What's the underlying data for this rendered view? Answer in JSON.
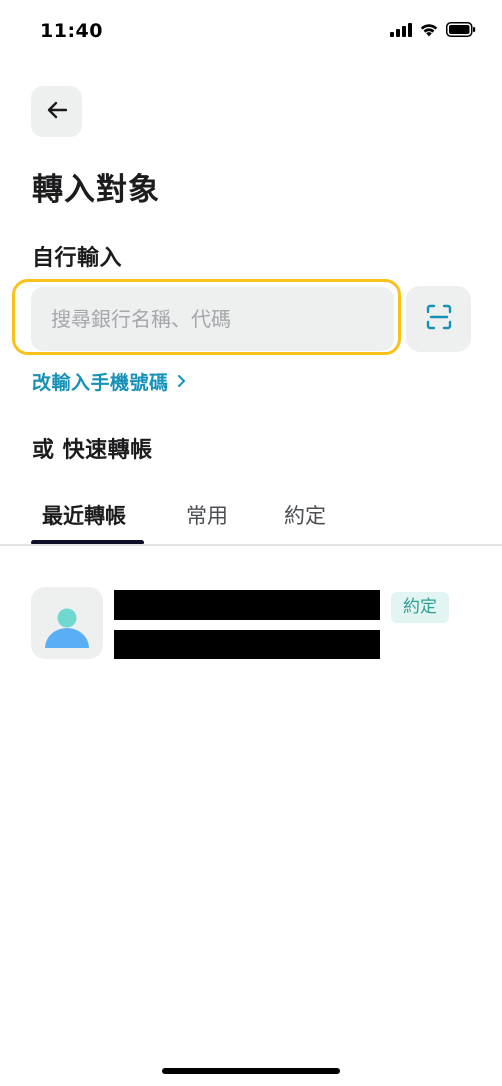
{
  "status_bar": {
    "time": "11:40"
  },
  "header": {
    "back_icon": "arrow-left-icon",
    "title": "轉入對象"
  },
  "manual_entry": {
    "label": "自行輸入",
    "search_placeholder": "搜尋銀行名稱、代碼",
    "search_value": "",
    "scan_icon": "scan-icon"
  },
  "phone_link": {
    "label": "改輸入手機號碼",
    "icon": "chevron-right-icon"
  },
  "quick_transfer": {
    "label": "或 快速轉帳",
    "tabs": [
      {
        "label": "最近轉帳",
        "active": true
      },
      {
        "label": "常用",
        "active": false
      },
      {
        "label": "約定",
        "active": false
      }
    ]
  },
  "recent_list": [
    {
      "avatar_icon": "user-avatar-icon",
      "badge": "約定"
    }
  ],
  "colors": {
    "accent_link": "#1692b8",
    "focus_ring": "#f8c21a",
    "tab_indicator": "#0d1027",
    "badge_bg": "#e3f5f3",
    "badge_text": "#2f9d92",
    "avatar_head": "#6fd9cf",
    "avatar_body": "#5aaef4"
  }
}
